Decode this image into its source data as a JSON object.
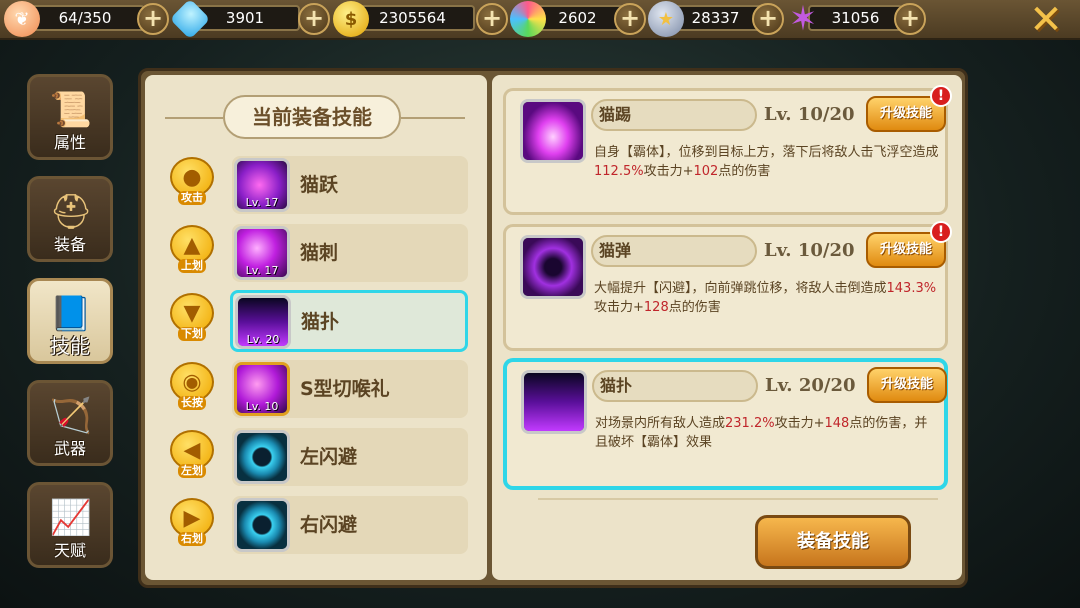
{
  "resources": [
    {
      "icon": "peach-icon",
      "value": "64/350"
    },
    {
      "icon": "diamond-icon",
      "value": "3901"
    },
    {
      "icon": "gold-coin-icon",
      "value": "2305564"
    },
    {
      "icon": "lollipop-icon",
      "value": "2602"
    },
    {
      "icon": "rank-badge-icon",
      "value": "28337"
    },
    {
      "icon": "purple-star-icon",
      "value": "31056"
    }
  ],
  "plus_symbol": "+",
  "close_symbol": "✕",
  "side_tabs": [
    {
      "label": "属性",
      "icon": "scroll-icon"
    },
    {
      "label": "装备",
      "icon": "helmet-icon"
    },
    {
      "label": "技能",
      "icon": "skill-book-icon"
    },
    {
      "label": "武器",
      "icon": "weapon-icon"
    },
    {
      "label": "天赋",
      "icon": "talent-chart-icon"
    }
  ],
  "panel_title": "当前装备技能",
  "equipped_skills": [
    {
      "gesture": "攻击",
      "name": "猫跃",
      "level": "Lv. 17"
    },
    {
      "gesture": "上划",
      "name": "猫刺",
      "level": "Lv. 17"
    },
    {
      "gesture": "下划",
      "name": "猫扑",
      "level": "Lv. 20"
    },
    {
      "gesture": "长按",
      "name": "S型切喉礼",
      "level": "Lv. 10"
    },
    {
      "gesture": "左划",
      "name": "左闪避",
      "level": ""
    },
    {
      "gesture": "右划",
      "name": "右闪避",
      "level": ""
    }
  ],
  "skill_cards": [
    {
      "name": "猫踢",
      "level": "Lv. 10/20",
      "upgrade_label": "升级技能",
      "alert": "!",
      "desc_parts": [
        "自身【霸体】，位移到目标上方，落下后将敌人击飞浮空造成",
        "112.5%",
        "攻击力+",
        "102",
        "点的伤害"
      ]
    },
    {
      "name": "猫弹",
      "level": "Lv. 10/20",
      "upgrade_label": "升级技能",
      "alert": "!",
      "desc_parts": [
        "大幅提升【闪避】，向前弹跳位移，将敌人击倒造成",
        "143.3%",
        "攻击力+",
        "128",
        "点的伤害"
      ]
    },
    {
      "name": "猫扑",
      "level": "Lv. 20/20",
      "upgrade_label": "升级技能",
      "alert": "",
      "desc_parts": [
        "对场景内所有敌人造成",
        "231.2%",
        "攻击力+",
        "148",
        "点的伤害，并且破坏【霸体】效果"
      ]
    }
  ],
  "equip_button": "装备技能",
  "colors": {
    "highlight_cyan": "#2fd6e8",
    "damage_red": "#c0262b",
    "gold_button": "#e08a10",
    "parchment": "#ece3c9"
  }
}
